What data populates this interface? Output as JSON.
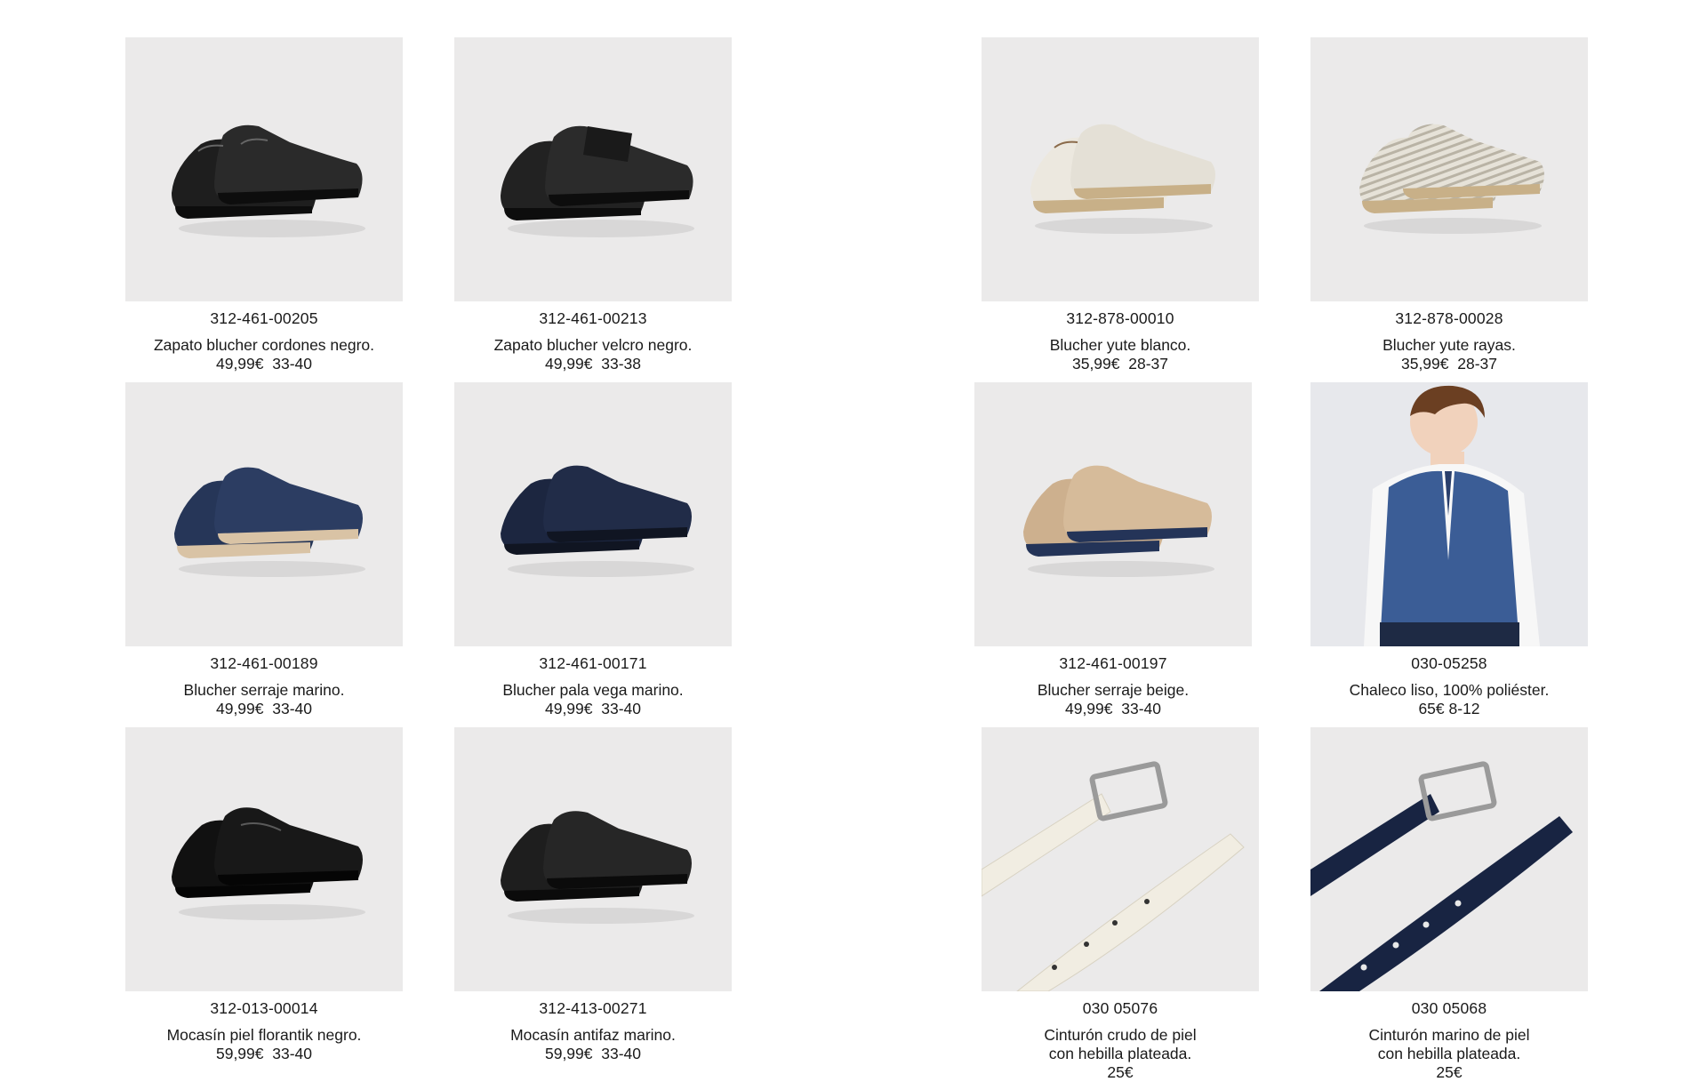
{
  "colors": {
    "background": "#ffffff",
    "photo_background": "#ebeaea",
    "text": "#1a1a1a"
  },
  "products": [
    {
      "code": "312-461-00205",
      "name": "Zapato blucher cordones negro.",
      "price": "49,99€  33-40",
      "icon": "black-lace-up-shoes"
    },
    {
      "code": "312-461-00213",
      "name": "Zapato blucher velcro negro.",
      "price": "49,99€  33-38",
      "icon": "black-velcro-shoes"
    },
    {
      "code": "312-878-00010",
      "name": "Blucher yute blanco.",
      "price": "35,99€  28-37",
      "icon": "white-jute-shoes"
    },
    {
      "code": "312-878-00028",
      "name": "Blucher yute rayas.",
      "price": "35,99€  28-37",
      "icon": "striped-jute-shoes"
    },
    {
      "code": "312-461-00189",
      "name": "Blucher serraje marino.",
      "price": "49,99€  33-40",
      "icon": "navy-suede-shoes"
    },
    {
      "code": "312-461-00171",
      "name": "Blucher pala vega marino.",
      "price": "49,99€  33-40",
      "icon": "navy-wingtip-shoes"
    },
    {
      "code": "312-461-00197",
      "name": "Blucher serraje beige.",
      "price": "49,99€  33-40",
      "icon": "beige-suede-shoes"
    },
    {
      "code": "030-05258",
      "name": "Chaleco  liso, 100% poliéster.",
      "price": "65€ 8-12",
      "icon": "boy-in-blue-vest"
    },
    {
      "code": "312-013-00014",
      "name": "Mocasín piel florantik negro.",
      "price": "59,99€  33-40",
      "icon": "black-patent-loafers"
    },
    {
      "code": "312-413-00271",
      "name": "Mocasín antifaz marino.",
      "price": "59,99€  33-40",
      "icon": "black-penny-loafers"
    },
    {
      "code": "030 05076",
      "name": "Cinturón crudo de piel\ncon hebilla plateada.",
      "price": "25€",
      "icon": "cream-leather-belt"
    },
    {
      "code": "030 05068",
      "name": "Cinturón marino de piel\ncon hebilla plateada.",
      "price": "25€",
      "icon": "navy-leather-belt"
    }
  ]
}
